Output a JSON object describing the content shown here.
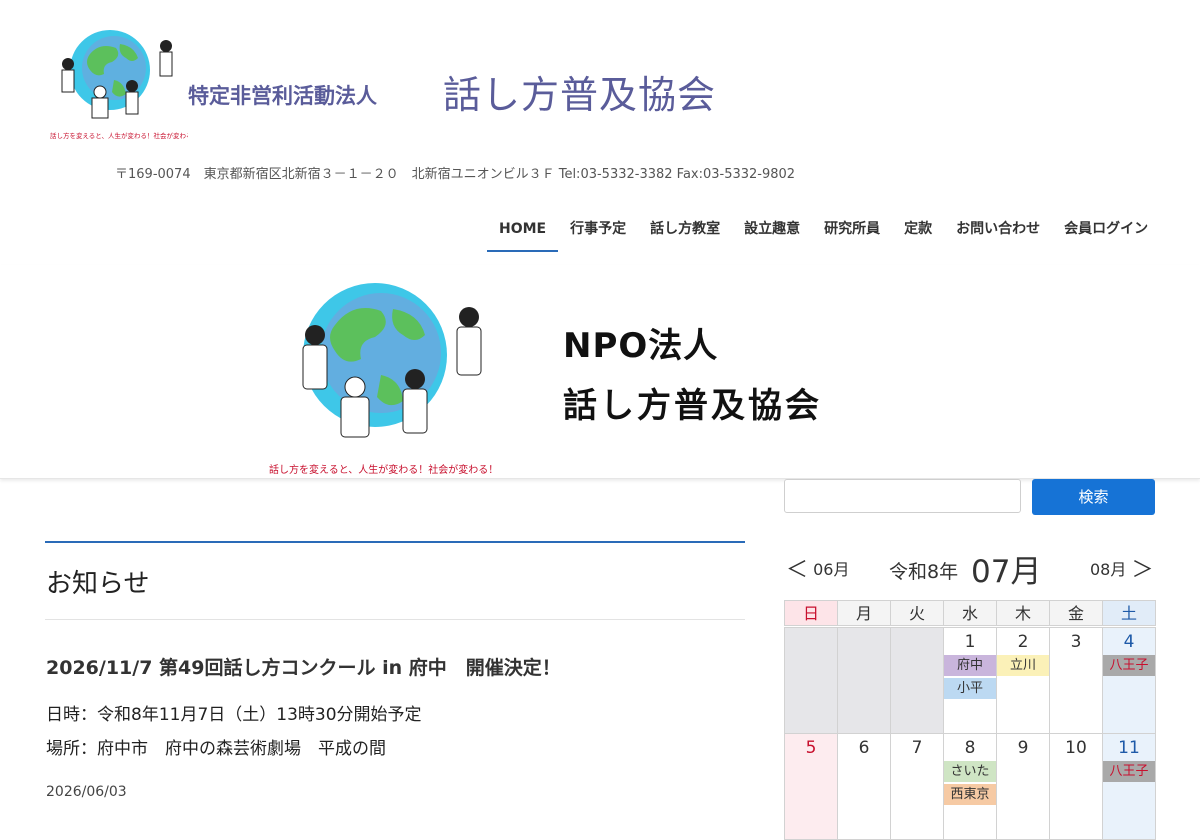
{
  "header": {
    "logo_caption": "話し方を変えると、人生が変わる！社会が変わる！",
    "org_type": "特定非営利活動法人",
    "org_name": "話し方普及協会",
    "address": "〒169-0074　東京都新宿区北新宿３－１－２０　北新宿ユニオンビル３Ｆ Tel:03-5332-3382 Fax:03-5332-9802"
  },
  "nav": {
    "items": [
      {
        "label": "HOME",
        "active": true
      },
      {
        "label": "行事予定"
      },
      {
        "label": "話し方教室"
      },
      {
        "label": "設立趣意"
      },
      {
        "label": "研究所員"
      },
      {
        "label": "定款"
      },
      {
        "label": "お問い合わせ"
      },
      {
        "label": "会員ログイン"
      }
    ]
  },
  "banner": {
    "line1": "NPO法人",
    "line2": "話し方普及協会",
    "caption": "話し方を変えると、人生が変わる！社会が変わる！"
  },
  "main": {
    "section_title": "お知らせ",
    "post": {
      "title": "2026/11/7 第49回話し方コンクール in 府中　開催決定！",
      "date_line": "日時：令和8年11月7日（土）13時30分開始予定",
      "place_line": "場所：府中市　府中の森芸術劇場　平成の間",
      "published": "2026/06/03"
    }
  },
  "sidebar": {
    "search": {
      "placeholder": "",
      "button_label": "検索"
    },
    "calendar": {
      "prev_label": "06月",
      "prev_arrow": "＜",
      "era": "令和8年",
      "month": "07月",
      "next_label": "08月",
      "next_arrow": "＞",
      "weekdays": [
        "日",
        "月",
        "火",
        "水",
        "木",
        "金",
        "土"
      ],
      "weeks": [
        [
          {
            "day": ""
          },
          {
            "day": ""
          },
          {
            "day": ""
          },
          {
            "day": "1",
            "events": [
              {
                "label": "府中",
                "color": "#c9b5dc"
              },
              {
                "label": "小平",
                "color": "#bcd9f2"
              }
            ]
          },
          {
            "day": "2",
            "events": [
              {
                "label": "立川",
                "color": "#fbf1b8"
              }
            ]
          },
          {
            "day": "3"
          },
          {
            "day": "4",
            "events": [
              {
                "label": "八王子",
                "color": "#a9a9a9",
                "text": "#c8102e"
              }
            ]
          }
        ],
        [
          {
            "day": "5"
          },
          {
            "day": "6"
          },
          {
            "day": "7"
          },
          {
            "day": "8",
            "events": [
              {
                "label": "さいた",
                "color": "#cfe5c4"
              },
              {
                "label": "西東京",
                "color": "#f6caa4"
              }
            ]
          },
          {
            "day": "9"
          },
          {
            "day": "10"
          },
          {
            "day": "11",
            "events": [
              {
                "label": "八王子",
                "color": "#a9a9a9",
                "text": "#c8102e"
              }
            ]
          }
        ]
      ]
    }
  },
  "colors": {
    "brand_text": "#5a5c9a",
    "accent_blue": "#1673d6",
    "rule_blue": "#2a6bb8"
  }
}
